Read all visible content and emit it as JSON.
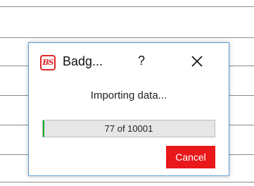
{
  "dialog": {
    "app_logo_text": "BS",
    "title": "Badg...",
    "help_label": "?",
    "status_text": "Importing data...",
    "progress": {
      "current": 77,
      "total": 10001,
      "text": "77 of 10001",
      "fill_color": "#06b025"
    },
    "cancel_label": "Cancel",
    "cancel_color": "#e8181b",
    "border_color": "#5b9bd5"
  },
  "icons": {
    "logo": "badge-studio-logo-icon",
    "help": "question-mark-icon",
    "close": "close-icon"
  }
}
